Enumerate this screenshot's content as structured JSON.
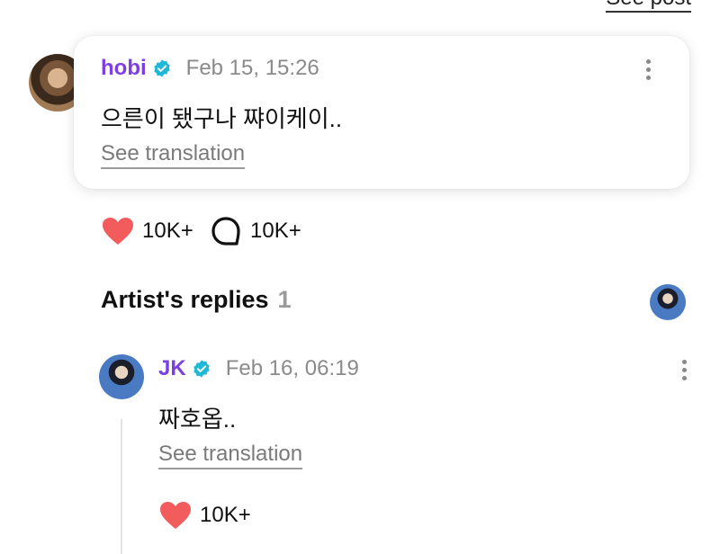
{
  "header": {
    "see_post": "See post"
  },
  "comment": {
    "author": "hobi",
    "timestamp": "Feb 15, 15:26",
    "text": "으른이 됐구나 쨔이케이..",
    "see_translation": "See translation",
    "likes": "10K+",
    "replies": "10K+"
  },
  "artist_replies": {
    "title": "Artist's replies",
    "count": "1",
    "reply": {
      "author": "JK",
      "timestamp": "Feb 16, 06:19",
      "text": "짜호옵..",
      "see_translation": "See translation",
      "likes": "10K+"
    }
  },
  "colors": {
    "author_name": "#7b3fe4",
    "verified": "#1fb8d6",
    "heart": "#f25c5c"
  },
  "icons": [
    "verified-icon",
    "more-icon",
    "heart-icon",
    "comment-bubble-icon"
  ]
}
